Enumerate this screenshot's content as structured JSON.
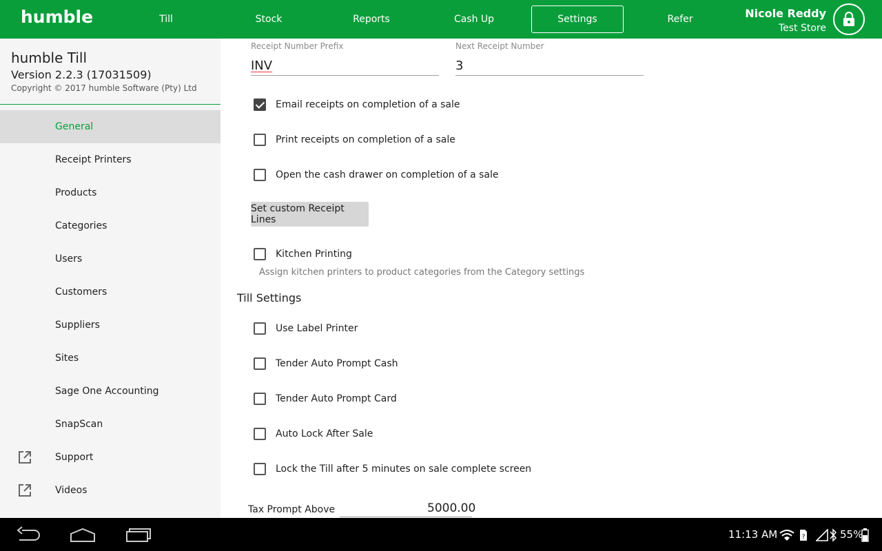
{
  "header": {
    "logo": "humble",
    "nav": [
      {
        "label": "Till"
      },
      {
        "label": "Stock"
      },
      {
        "label": "Reports"
      },
      {
        "label": "Cash Up"
      },
      {
        "label": "Settings",
        "active": true
      },
      {
        "label": "Refer"
      }
    ],
    "user_name": "Nicole Reddy",
    "store_name": "Test Store",
    "lock_icon": "lock-icon"
  },
  "sidebar": {
    "app_title": "humble Till",
    "version": "Version 2.2.3 (17031509)",
    "copyright": "Copyright © 2017 humble Software (Pty) Ltd",
    "items": [
      {
        "label": "General",
        "active": true
      },
      {
        "label": "Receipt Printers"
      },
      {
        "label": "Products"
      },
      {
        "label": "Categories"
      },
      {
        "label": "Users"
      },
      {
        "label": "Customers"
      },
      {
        "label": "Suppliers"
      },
      {
        "label": "Sites"
      },
      {
        "label": "Sage One Accounting"
      },
      {
        "label": "SnapScan"
      },
      {
        "label": "Support",
        "icon": "external-link-icon"
      },
      {
        "label": "Videos",
        "icon": "external-link-icon"
      }
    ]
  },
  "main": {
    "receipt_prefix_label": "Receipt Number Prefix",
    "receipt_prefix_value": "INV",
    "next_receipt_label": "Next Receipt Number",
    "next_receipt_value": "3",
    "receipt_options": [
      {
        "label": "Email receipts on completion of a sale",
        "checked": true
      },
      {
        "label": "Print receipts on completion of a sale",
        "checked": false
      },
      {
        "label": "Open the cash drawer on completion of a sale",
        "checked": false
      }
    ],
    "custom_lines_button": "Set custom Receipt Lines",
    "kitchen_printing_label": "Kitchen Printing",
    "kitchen_printing_checked": false,
    "kitchen_helper": "Assign kitchen printers to product categories from the Category settings",
    "till_settings_title": "Till Settings",
    "till_options": [
      {
        "label": "Use Label Printer",
        "checked": false
      },
      {
        "label": "Tender Auto Prompt Cash",
        "checked": false
      },
      {
        "label": "Tender Auto Prompt Card",
        "checked": false
      },
      {
        "label": "Auto Lock After Sale",
        "checked": false
      },
      {
        "label": "Lock the Till after 5 minutes on sale complete screen",
        "checked": false
      }
    ],
    "tax_prompt_label": "Tax Prompt Above",
    "tax_prompt_value": "5000.00"
  },
  "statusbar": {
    "time": "11:13 AM",
    "battery": "55%",
    "icons": [
      "back-icon",
      "home-icon",
      "recent-apps-icon",
      "wifi-icon",
      "sim-icon",
      "signal-icon",
      "bluetooth-icon",
      "battery-icon"
    ]
  },
  "colors": {
    "brand": "#0a9e3b"
  }
}
